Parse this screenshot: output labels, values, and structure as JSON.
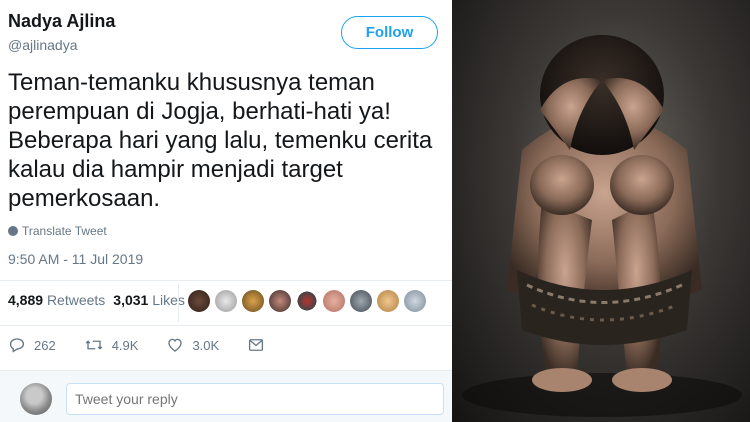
{
  "tweet": {
    "display_name": "Nadya Ajlina",
    "handle": "@ajlinadya",
    "follow_label": "Follow",
    "text_lines": [
      "Teman-temanku khususnya teman",
      "perempuan di Jogja, berhati-hati ya!",
      "Beberapa hari yang lalu, temenku cerita",
      "kalau dia hampir menjadi target",
      "pemerkosaan."
    ],
    "translate_label": "Translate Tweet",
    "timestamp": "9:50 AM - 11 Jul 2019",
    "retweets_count": "4,889",
    "retweets_label": "Retweets",
    "likes_count": "3,031",
    "likes_label": "Likes",
    "reply_count": "262",
    "retweet_count_short": "4.9K",
    "like_count_short": "3.0K",
    "reply_placeholder": "Tweet your reply"
  },
  "colors": {
    "accent": "#1da1f2",
    "secondary_text": "#657786",
    "divider": "#e6ecf0"
  },
  "icons": [
    "globe-icon",
    "reply-icon",
    "retweet-icon",
    "like-icon",
    "message-icon"
  ]
}
